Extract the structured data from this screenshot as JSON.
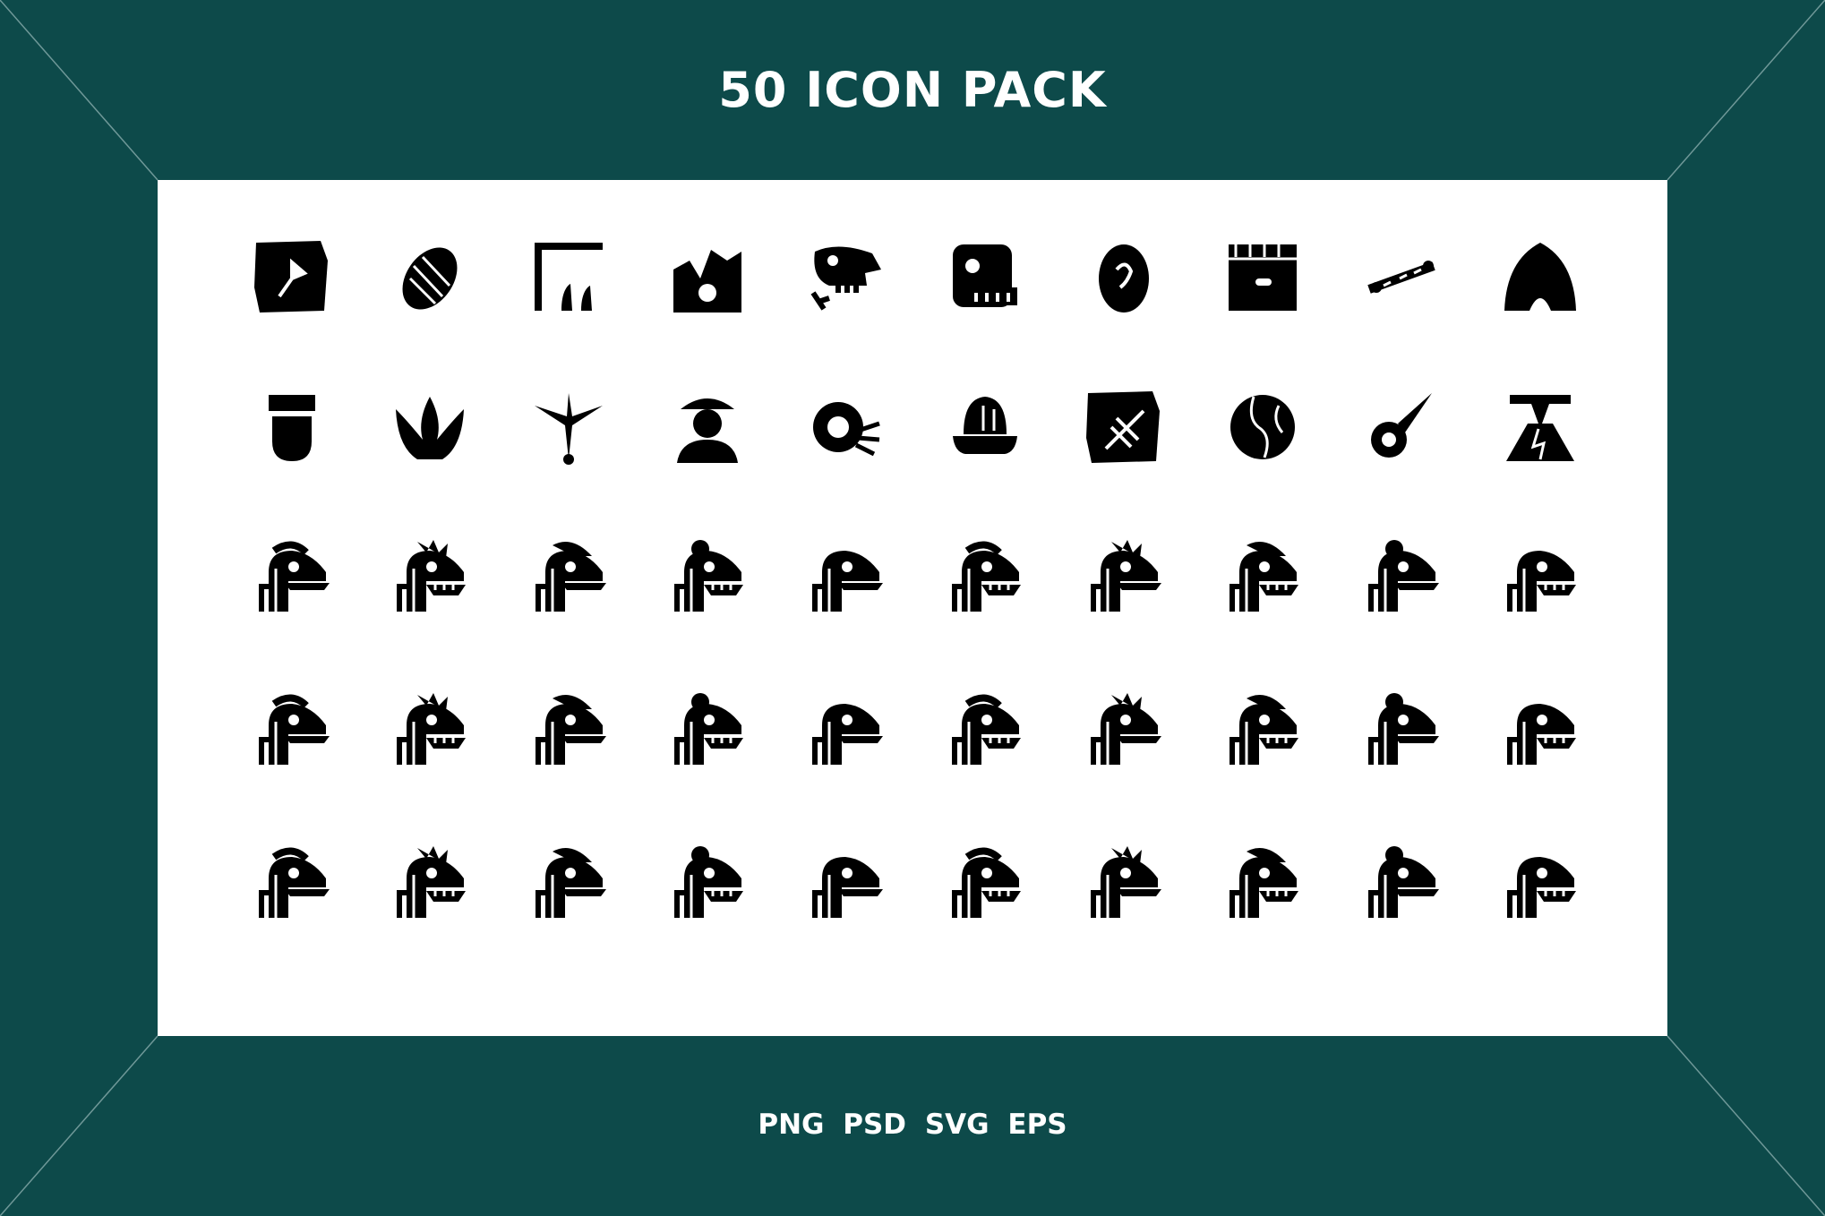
{
  "header": {
    "title": "50 ICON PACK"
  },
  "footer": {
    "formats": "PNG  PSD  SVG  EPS"
  },
  "colors": {
    "background": "#0d4a4a",
    "panel": "#ffffff",
    "icon": "#000000"
  },
  "icons": [
    "fossil-leaf-stone-icon",
    "trilobite-icon",
    "dino-footprint-measure-icon",
    "excavation-cliff-icon",
    "trex-skull-bones-icon",
    "dino-skull-icon",
    "dino-egg-icon",
    "soil-layers-fossil-icon",
    "bone-chain-icon",
    "cave-icon",
    "tooth-icon",
    "three-toe-footprint-icon",
    "bird-footprint-icon",
    "paleontologist-icon",
    "ammonite-icon",
    "hatching-egg-nest-icon",
    "fossil-dragonfly-stone-icon",
    "earth-icon",
    "meteor-icon",
    "volcano-icon",
    "pachycephalosaurus-icon",
    "brachiosaurus-icon",
    "ankylosaurus-icon",
    "triceratops-icon",
    "velociraptor-icon",
    "trex-roar-icon",
    "dilophosaurus-icon",
    "corythosaurus-icon",
    "spinosaurus-icon",
    "carnotaurus-icon",
    "oviraptor-icon",
    "iguanodon-icon",
    "stegosaurus-icon",
    "pteranodon-icon",
    "allosaurus-icon",
    "diplodocus-icon",
    "crocodile-dino-icon",
    "tyrannosaurus-icon",
    "gallimimus-icon",
    "apatosaurus-icon",
    "troodon-icon",
    "dracorex-icon",
    "parasaurolophus-crest-icon",
    "styracosaurus-icon",
    "baryonyx-icon",
    "giganotosaurus-icon",
    "lambeosaurus-icon",
    "protoceratops-icon",
    "sarcosuchus-icon",
    "megalosaurus-icon"
  ]
}
